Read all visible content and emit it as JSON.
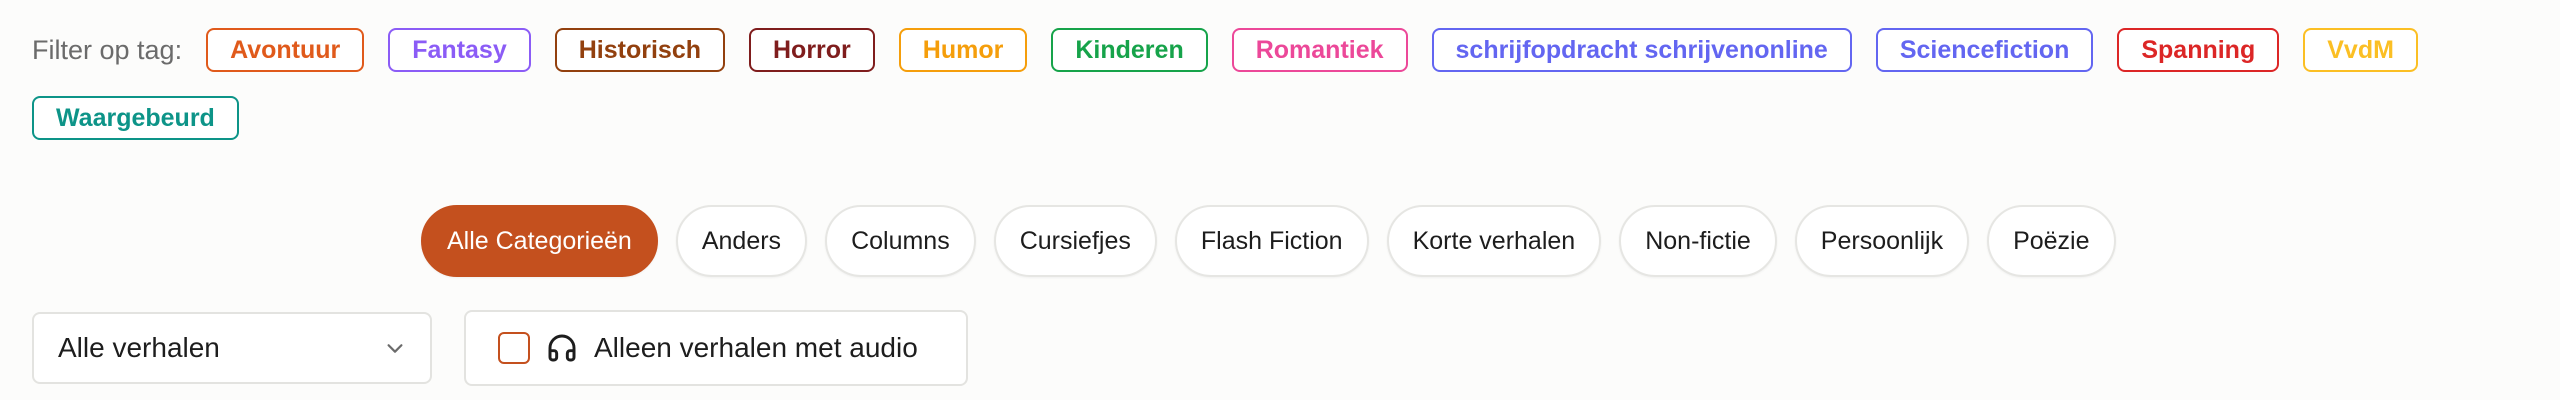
{
  "tag_filter": {
    "label": "Filter op tag:",
    "tags": [
      {
        "label": "Avontuur",
        "color": "#e05a1b"
      },
      {
        "label": "Fantasy",
        "color": "#8b5cf6"
      },
      {
        "label": "Historisch",
        "color": "#92400e"
      },
      {
        "label": "Horror",
        "color": "#7f1d1d"
      },
      {
        "label": "Humor",
        "color": "#f59e0b"
      },
      {
        "label": "Kinderen",
        "color": "#16a34a"
      },
      {
        "label": "Romantiek",
        "color": "#ec4899"
      },
      {
        "label": "schrijfopdracht schrijvenonline",
        "color": "#6366f1"
      },
      {
        "label": "Sciencefiction",
        "color": "#6366f1"
      },
      {
        "label": "Spanning",
        "color": "#dc2626"
      },
      {
        "label": "VvdM",
        "color": "#fbbf24"
      },
      {
        "label": "Waargebeurd",
        "color": "#0d9488"
      }
    ]
  },
  "categories": {
    "active_index": 0,
    "items": [
      "Alle Categorieën",
      "Anders",
      "Columns",
      "Cursiefjes",
      "Flash Fiction",
      "Korte verhalen",
      "Non-fictie",
      "Persoonlijk",
      "Poëzie"
    ]
  },
  "story_select": {
    "value": "Alle verhalen",
    "icon": "chevron-down-icon"
  },
  "audio_filter": {
    "label": "Alleen verhalen met audio",
    "checked": false,
    "icon": "headphones-icon",
    "accent": "#c4501e"
  }
}
